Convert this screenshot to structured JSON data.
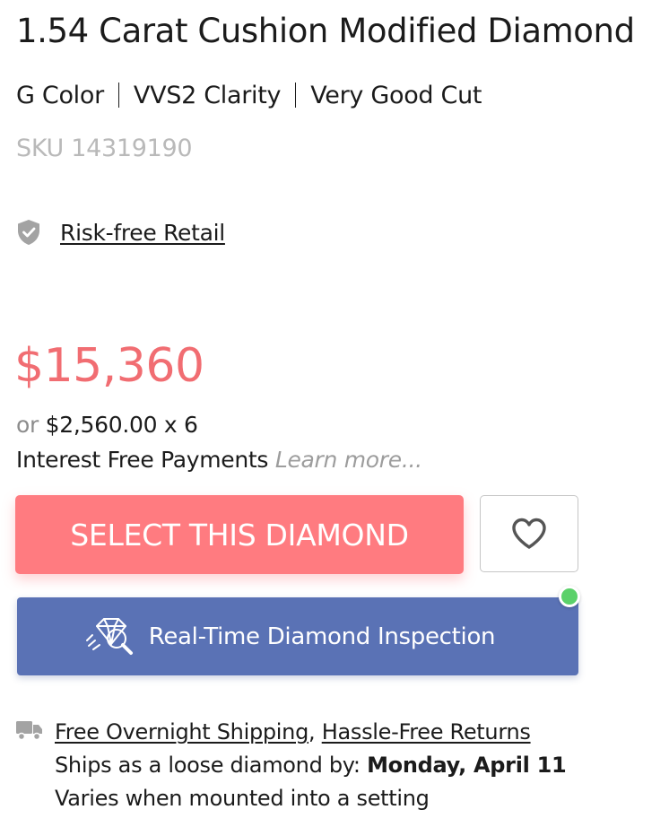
{
  "product": {
    "title": "1.54 Carat Cushion Modified Diamond",
    "color": "G Color",
    "clarity": "VVS2 Clarity",
    "cut": "Very Good Cut",
    "sku": "SKU 14319190"
  },
  "guarantee": {
    "icon": "shield-check-icon",
    "label": "Risk-free Retail"
  },
  "pricing": {
    "price": "$15,360",
    "installment_prefix": "or",
    "installment_amount": "$2,560.00 x 6",
    "interest_text": "Interest Free Payments",
    "learn_more": "Learn more..."
  },
  "actions": {
    "select_label": "SELECT THIS DIAMOND",
    "wishlist_icon": "heart-icon",
    "inspection_label": "Real-Time Diamond Inspection",
    "inspection_icon": "diamond-magnifier-icon"
  },
  "shipping": {
    "icon": "truck-icon",
    "free_shipping": "Free Overnight Shipping",
    "separator": ",",
    "returns": "Hassle-Free Returns",
    "ships_prefix": "Ships as a loose diamond by:",
    "ship_date": "Monday, April 11",
    "note": "Varies when mounted into a setting"
  },
  "colors": {
    "price": "#f16d72",
    "select_button": "#ff7b80",
    "inspection_button": "#5a72b5",
    "online_indicator": "#5bd16a",
    "sku": "#b9b9b9"
  }
}
